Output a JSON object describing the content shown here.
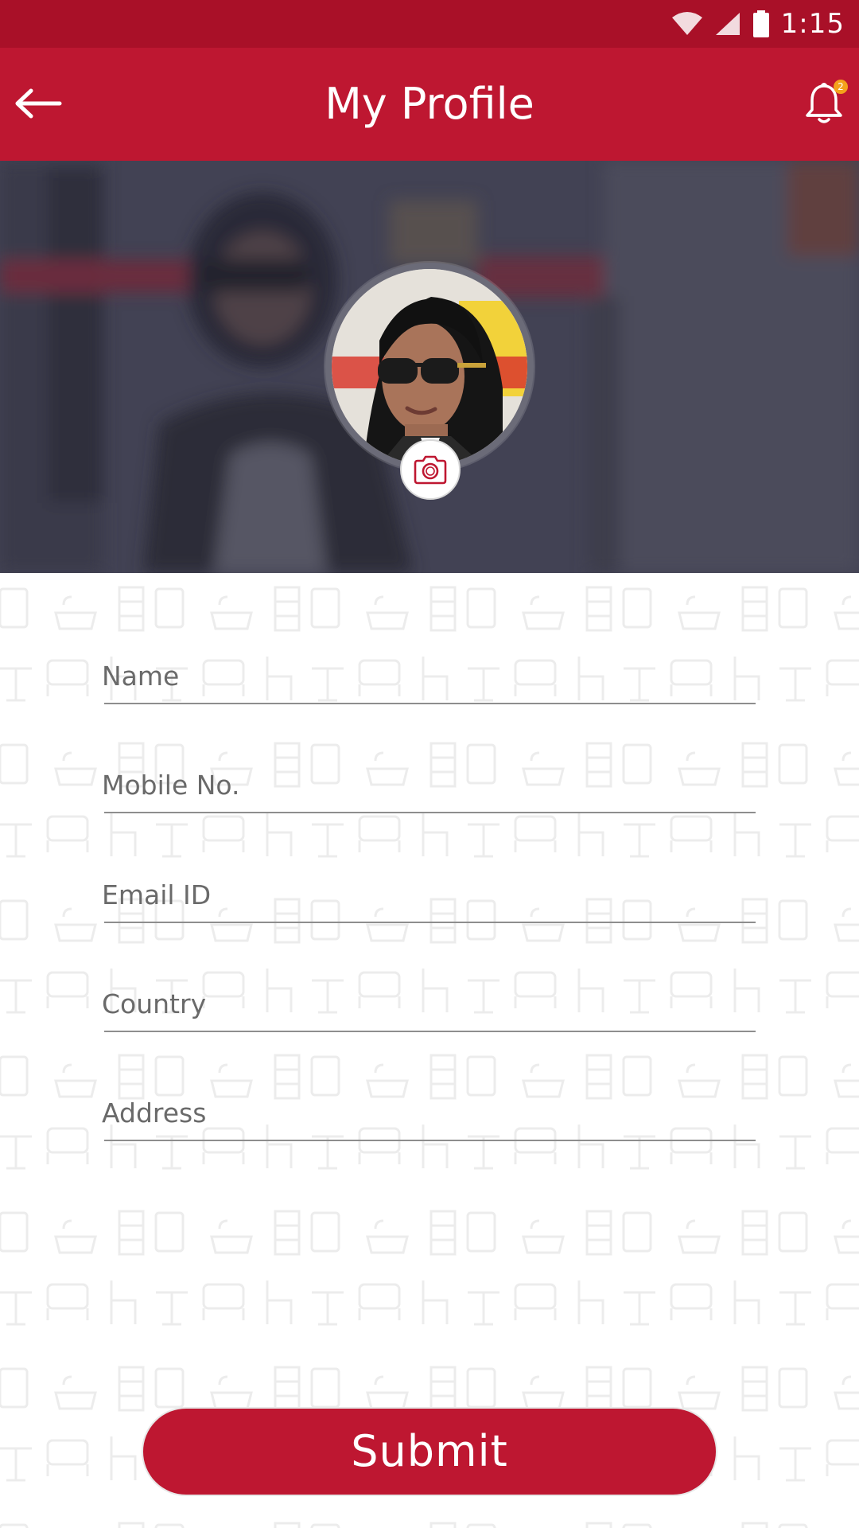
{
  "status_bar": {
    "time": "1:15",
    "icons": [
      "wifi-icon",
      "signal-icon",
      "battery-icon"
    ]
  },
  "app_bar": {
    "title": "My Profile",
    "back_icon": "back-arrow-icon",
    "bell_icon": "bell-icon",
    "notification_count": "2"
  },
  "profile": {
    "avatar": "profile-photo",
    "camera_icon": "camera-icon"
  },
  "form": {
    "fields": [
      {
        "label": "Name"
      },
      {
        "label": "Mobile No."
      },
      {
        "label": "Email ID"
      },
      {
        "label": "Country"
      },
      {
        "label": "Address"
      }
    ],
    "submit_label": "Submit"
  },
  "colors": {
    "status_bar": "#a91028",
    "app_bar": "#be1731",
    "accent": "#be1731",
    "badge": "#f4a21b"
  }
}
